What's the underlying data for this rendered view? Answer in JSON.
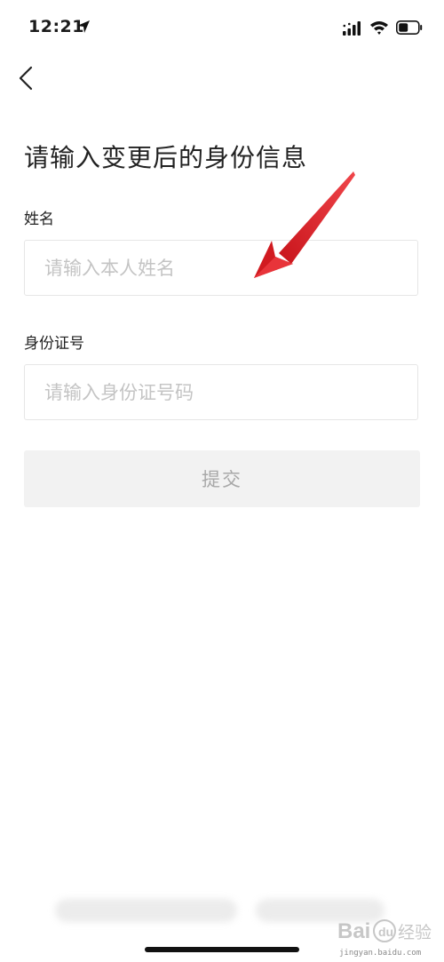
{
  "status_bar": {
    "time": "12:21"
  },
  "page": {
    "title": "请输入变更后的身份信息"
  },
  "form": {
    "name_label": "姓名",
    "name_placeholder": "请输入本人姓名",
    "name_value": "",
    "id_label": "身份证号",
    "id_placeholder": "请输入身份证号码",
    "id_value": "",
    "submit_label": "提交"
  },
  "watermark": {
    "text": "Bai 经验",
    "url": "jingyan.baidu.com"
  },
  "icons": {
    "back": "chevron-left-icon",
    "location": "location-arrow-icon",
    "signal": "cellular-signal-icon",
    "wifi": "wifi-icon",
    "battery": "battery-icon",
    "annotation": "red-arrow-icon"
  },
  "colors": {
    "annotation_red": "#e0262c",
    "submit_bg": "#f2f2f2",
    "submit_text": "#a8a8a8",
    "placeholder": "#c4c4c4",
    "border": "#e6e6e6"
  }
}
